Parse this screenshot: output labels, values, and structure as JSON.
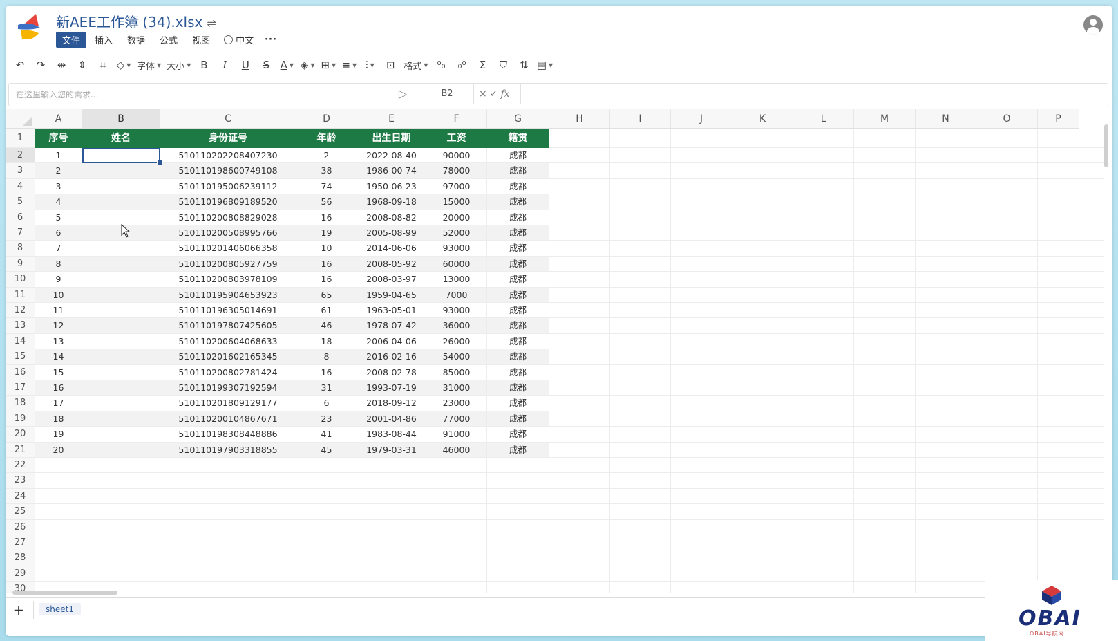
{
  "header": {
    "title": "新AEE工作簿 (34).xlsx",
    "sync_symbol": "⇌",
    "menu": [
      "文件",
      "插入",
      "数据",
      "公式",
      "视图"
    ],
    "active_menu_index": 0,
    "language": "中文",
    "more": "···"
  },
  "toolbar": {
    "font_label": "字体",
    "size_label": "大小",
    "bold": "B",
    "italic": "I",
    "underline": "U",
    "strike": "S",
    "font_color": "A",
    "format_label": "格式",
    "sum": "Σ"
  },
  "formula_bar": {
    "ai_placeholder": "在这里输入您的需求...",
    "cell_ref": "B2",
    "cancel": "×",
    "confirm": "✓",
    "fx": "fx"
  },
  "grid": {
    "columns": [
      "A",
      "B",
      "C",
      "D",
      "E",
      "F",
      "G",
      "H",
      "I",
      "J",
      "K",
      "L",
      "M",
      "N",
      "O",
      "P"
    ],
    "selected_column": "B",
    "selected_row": 2,
    "row_numbers": [
      1,
      2,
      3,
      4,
      5,
      6,
      7,
      8,
      9,
      10,
      11,
      12,
      13,
      14,
      15,
      16,
      17,
      18,
      19,
      20,
      21,
      22,
      23,
      24,
      25,
      26,
      27,
      28,
      29,
      30
    ],
    "table_headers": [
      "序号",
      "姓名",
      "身份证号",
      "年龄",
      "出生日期",
      "工资",
      "籍贯"
    ],
    "rows": [
      [
        "1",
        "",
        "510110202208407230",
        "2",
        "2022-08-40",
        "90000",
        "成都"
      ],
      [
        "2",
        "",
        "510110198600749108",
        "38",
        "1986-00-74",
        "78000",
        "成都"
      ],
      [
        "3",
        "",
        "510110195006239112",
        "74",
        "1950-06-23",
        "97000",
        "成都"
      ],
      [
        "4",
        "",
        "510110196809189520",
        "56",
        "1968-09-18",
        "15000",
        "成都"
      ],
      [
        "5",
        "",
        "510110200808829028",
        "16",
        "2008-08-82",
        "20000",
        "成都"
      ],
      [
        "6",
        "",
        "510110200508995766",
        "19",
        "2005-08-99",
        "52000",
        "成都"
      ],
      [
        "7",
        "",
        "510110201406066358",
        "10",
        "2014-06-06",
        "93000",
        "成都"
      ],
      [
        "8",
        "",
        "510110200805927759",
        "16",
        "2008-05-92",
        "60000",
        "成都"
      ],
      [
        "9",
        "",
        "510110200803978109",
        "16",
        "2008-03-97",
        "13000",
        "成都"
      ],
      [
        "10",
        "",
        "510110195904653923",
        "65",
        "1959-04-65",
        "7000",
        "成都"
      ],
      [
        "11",
        "",
        "510110196305014691",
        "61",
        "1963-05-01",
        "93000",
        "成都"
      ],
      [
        "12",
        "",
        "510110197807425605",
        "46",
        "1978-07-42",
        "36000",
        "成都"
      ],
      [
        "13",
        "",
        "510110200604068633",
        "18",
        "2006-04-06",
        "26000",
        "成都"
      ],
      [
        "14",
        "",
        "510110201602165345",
        "8",
        "2016-02-16",
        "54000",
        "成都"
      ],
      [
        "15",
        "",
        "510110200802781424",
        "16",
        "2008-02-78",
        "85000",
        "成都"
      ],
      [
        "16",
        "",
        "510110199307192594",
        "31",
        "1993-07-19",
        "31000",
        "成都"
      ],
      [
        "17",
        "",
        "510110201809129177",
        "6",
        "2018-09-12",
        "23000",
        "成都"
      ],
      [
        "18",
        "",
        "510110200104867671",
        "23",
        "2001-04-86",
        "77000",
        "成都"
      ],
      [
        "19",
        "",
        "510110198308448886",
        "41",
        "1983-08-44",
        "91000",
        "成都"
      ],
      [
        "20",
        "",
        "510110197903318855",
        "45",
        "1979-03-31",
        "46000",
        "成都"
      ]
    ]
  },
  "sheets": {
    "add": "+",
    "tabs": [
      "sheet1"
    ]
  },
  "watermark": {
    "text": "OBAI",
    "sub": "OBAI导航网"
  },
  "colors": {
    "accent": "#2b5797",
    "table_header": "#1e7a45",
    "zebra": "#f2f2f2"
  }
}
